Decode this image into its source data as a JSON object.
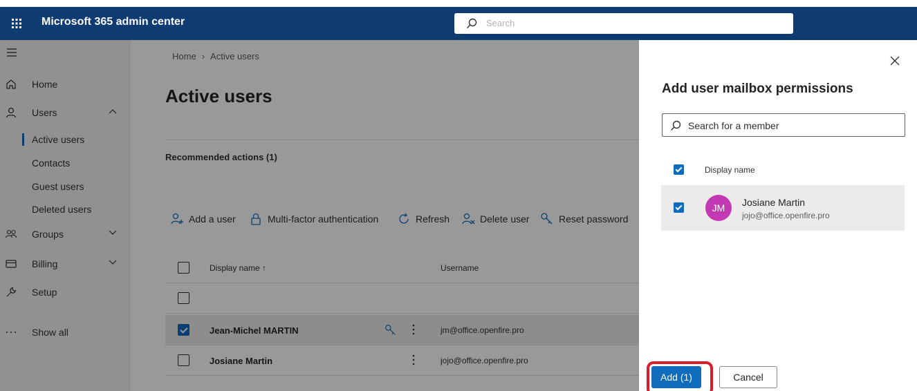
{
  "app": {
    "title": "Microsoft 365 admin center",
    "search_placeholder": "Search"
  },
  "sidebar": {
    "items": [
      {
        "label": "Home",
        "icon": "home-icon"
      },
      {
        "label": "Users",
        "icon": "person-icon",
        "expanded": true
      },
      {
        "label": "Groups",
        "icon": "groups-icon",
        "expanded": false
      },
      {
        "label": "Billing",
        "icon": "billing-icon",
        "expanded": false
      },
      {
        "label": "Setup",
        "icon": "wrench-icon"
      },
      {
        "label": "Show all",
        "icon": "ellipsis-icon"
      }
    ],
    "users_subitems": [
      {
        "label": "Active users",
        "active": true
      },
      {
        "label": "Contacts"
      },
      {
        "label": "Guest users"
      },
      {
        "label": "Deleted users"
      }
    ]
  },
  "main": {
    "breadcrumb": [
      "Home",
      "Active users"
    ],
    "title": "Active users",
    "recommended_actions": "Recommended actions (1)",
    "toolbar": [
      {
        "label": "Add a user",
        "icon": "add-user-icon"
      },
      {
        "label": "Multi-factor authentication",
        "icon": "lock-icon"
      },
      {
        "label": "Refresh",
        "icon": "refresh-icon"
      },
      {
        "label": "Delete user",
        "icon": "delete-user-icon"
      },
      {
        "label": "Reset password",
        "icon": "key-icon"
      }
    ],
    "table": {
      "columns": [
        "Display name ↑",
        "Username"
      ],
      "rows": [
        {
          "name": "",
          "username": "",
          "checked": false
        },
        {
          "name": "Jean-Michel MARTIN",
          "username": "jm@office.openfire.pro",
          "checked": true
        },
        {
          "name": "Josiane Martin",
          "username": "jojo@office.openfire.pro",
          "checked": false
        }
      ]
    }
  },
  "panel": {
    "title": "Add user mailbox permissions",
    "search_placeholder": "Search for a member",
    "column": "Display name",
    "member": {
      "initials": "JM",
      "name": "Josiane Martin",
      "email": "jojo@office.openfire.pro",
      "avatar_color": "#c239b3"
    },
    "add_label": "Add (1)",
    "cancel_label": "Cancel"
  },
  "colors": {
    "topbar": "#0f3b73",
    "accent": "#0f6cbd",
    "highlight": "#d81e2a"
  }
}
